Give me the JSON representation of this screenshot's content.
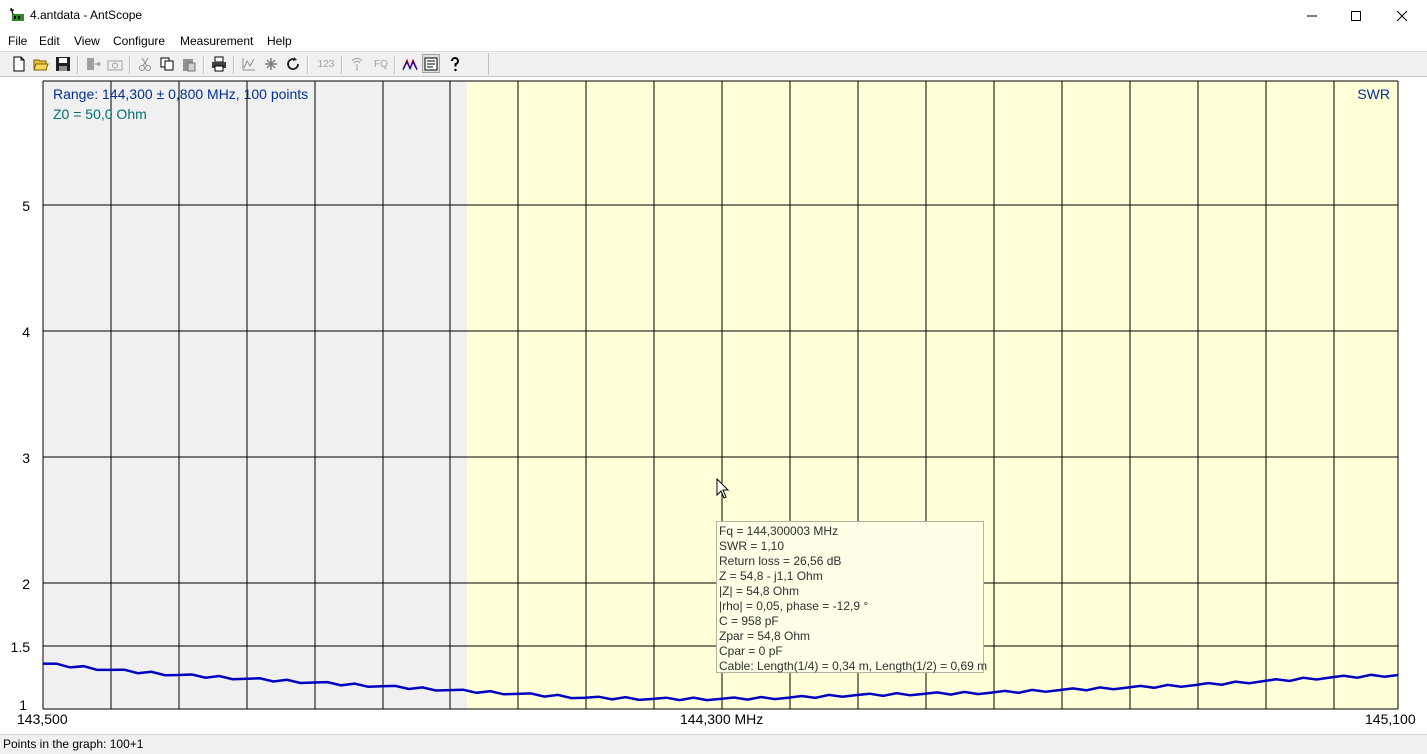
{
  "window": {
    "title": "4.antdata - AntScope",
    "minimize_glyph": "—",
    "maximize_glyph": "☐",
    "close_glyph": "✕"
  },
  "menu": [
    {
      "label": "File"
    },
    {
      "label": "Edit"
    },
    {
      "label": "View"
    },
    {
      "label": "Configure"
    },
    {
      "label": "Measurement"
    },
    {
      "label": "Help"
    }
  ],
  "toolbar": {
    "icons": [
      "new-file-icon",
      "open-folder-icon",
      "save-icon",
      "export-icon",
      "camera-icon",
      "cut-icon",
      "copy-icon",
      "paste-icon",
      "print-icon",
      "graph-icon",
      "marker-icon",
      "refresh-icon",
      "numbers-icon",
      "antenna-icon",
      "fq-icon",
      "swr-curves-icon",
      "tooltip-toggle-icon",
      "help-icon"
    ],
    "text_123": "123",
    "text_fq": "FQ"
  },
  "graph": {
    "range_text": "Range: 144,300 ± 0,800 MHz, 100 points",
    "z0_text": "Z0 = 50,0 Ohm",
    "mode_label": "SWR",
    "x_labels": {
      "left": "143,500",
      "center": "144,300 MHz",
      "right": "145,100"
    },
    "y_labels": [
      "5",
      "4",
      "3",
      "2",
      "1.5",
      "1"
    ],
    "colors": {
      "curve": "#0000c0",
      "band_bg": "#ffffd8",
      "outside_bg": "#f0f0f0",
      "grid": "#000000"
    }
  },
  "chart_data": {
    "type": "line",
    "title": "",
    "xlabel": "MHz",
    "ylabel": "SWR",
    "xlim": [
      143.5,
      145.1
    ],
    "ylim": [
      1,
      6
    ],
    "series": [
      {
        "name": "SWR",
        "x": [
          143.5,
          143.58,
          143.66,
          143.74,
          143.82,
          143.9,
          143.98,
          144.06,
          144.14,
          144.22,
          144.3,
          144.38,
          144.46,
          144.54,
          144.62,
          144.7,
          144.78,
          144.86,
          144.94,
          145.02,
          145.1
        ],
        "y": [
          1.36,
          1.31,
          1.27,
          1.24,
          1.21,
          1.18,
          1.15,
          1.12,
          1.09,
          1.08,
          1.08,
          1.09,
          1.11,
          1.12,
          1.13,
          1.15,
          1.17,
          1.19,
          1.22,
          1.25,
          1.27
        ]
      }
    ]
  },
  "tooltip": {
    "lines": [
      "Fq = 144,300003 MHz",
      "SWR = 1,10",
      "Return loss = 26,56 dB",
      "Z = 54,8 - j1,1 Ohm",
      "|Z| = 54,8 Ohm",
      "|rho| = 0,05, phase = -12,9 °",
      "C = 958 pF",
      "Zpar = 54,8 Ohm",
      "Cpar = 0 pF",
      "Cable: Length(1/4) = 0,34 m, Length(1/2) = 0,69 m"
    ]
  },
  "status": {
    "text": "Points in the graph: 100+1"
  }
}
